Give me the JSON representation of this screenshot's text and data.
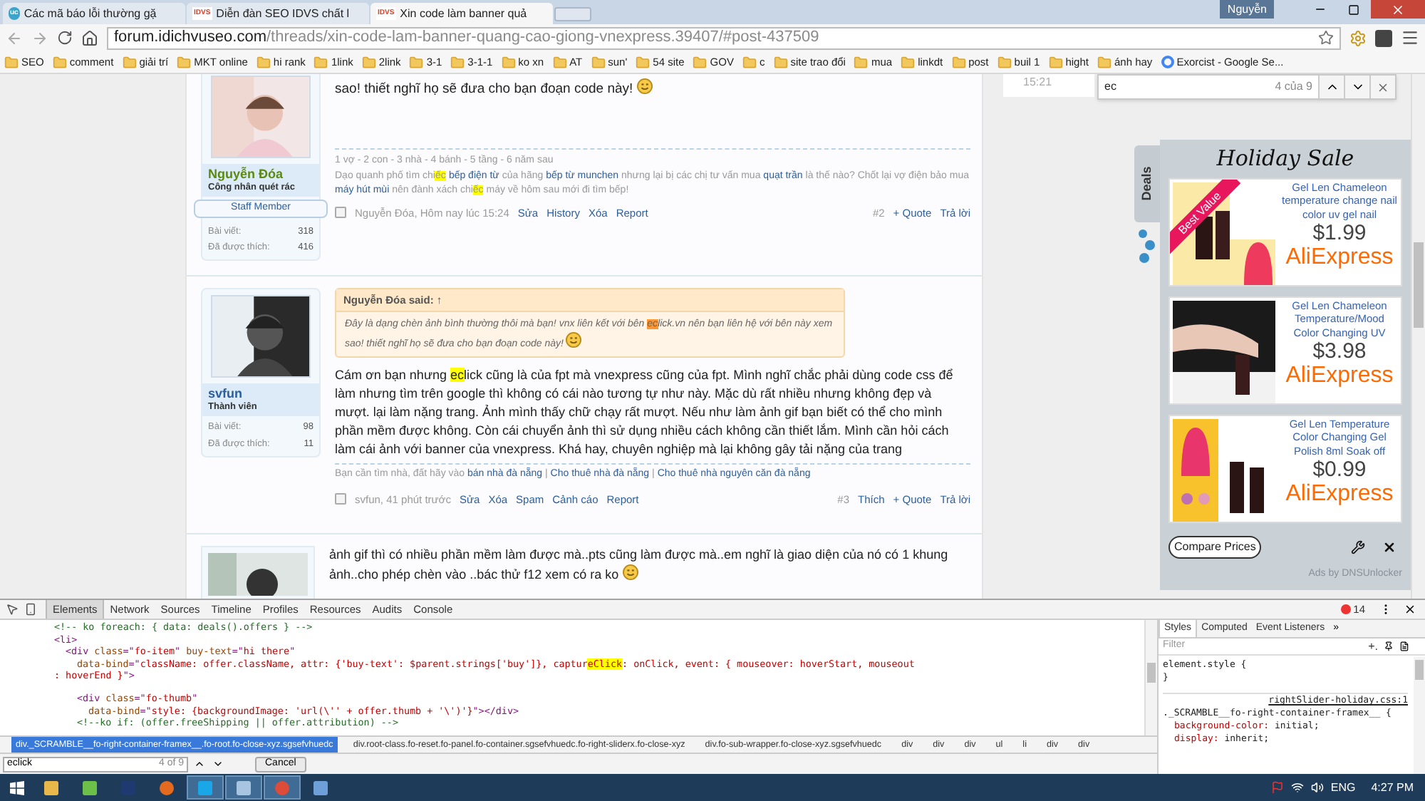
{
  "browser": {
    "tabs": [
      {
        "title": "Các mã báo lỗi thường gặ",
        "icon_text": "uc",
        "selected": false
      },
      {
        "title": "Diễn đàn SEO IDVS chất l",
        "icon_text": "IDVS",
        "selected": false
      },
      {
        "title": "Xin code làm banner quả",
        "icon_text": "IDVS",
        "selected": true
      }
    ],
    "profile": "Nguyễn",
    "address": {
      "host": "forum.idichvuseo.com",
      "path": "/threads/xin-code-lam-banner-quang-cao-giong-vnexpress.39407/#post-437509"
    },
    "bookmarks": [
      {
        "label": "SEO",
        "kind": "folder"
      },
      {
        "label": "comment",
        "kind": "folder"
      },
      {
        "label": "giải trí",
        "kind": "folder"
      },
      {
        "label": "MKT online",
        "kind": "folder"
      },
      {
        "label": "hi rank",
        "kind": "folder"
      },
      {
        "label": "1link",
        "kind": "folder"
      },
      {
        "label": "2link",
        "kind": "folder"
      },
      {
        "label": "3-1",
        "kind": "folder"
      },
      {
        "label": "3-1-1",
        "kind": "folder"
      },
      {
        "label": "ko xn",
        "kind": "folder"
      },
      {
        "label": "AT",
        "kind": "folder"
      },
      {
        "label": "sun'",
        "kind": "folder"
      },
      {
        "label": "54 site",
        "kind": "folder"
      },
      {
        "label": "GOV",
        "kind": "folder"
      },
      {
        "label": "c",
        "kind": "folder"
      },
      {
        "label": "site trao đổi",
        "kind": "folder"
      },
      {
        "label": "mua",
        "kind": "folder"
      },
      {
        "label": "linkdt",
        "kind": "folder"
      },
      {
        "label": "post",
        "kind": "folder"
      },
      {
        "label": "buil 1",
        "kind": "folder"
      },
      {
        "label": "hight",
        "kind": "folder"
      },
      {
        "label": "ánh hay",
        "kind": "folder"
      },
      {
        "label": "Exorcist - Google Se...",
        "kind": "page"
      }
    ]
  },
  "posts": [
    {
      "user": {
        "name": "Nguyễn Đóa",
        "title": "Công nhân quét rác",
        "badge": "Staff Member",
        "stats": [
          {
            "label": "Bài viết:",
            "value": "318"
          },
          {
            "label": "Đã được thích:",
            "value": "416"
          }
        ]
      },
      "body": [
        {
          "kind": "plain",
          "text": "sao! thiết nghĩ họ sẽ đưa cho bạn đoạn code này! "
        },
        {
          "kind": "emoji"
        }
      ],
      "signature": [
        [
          {
            "kind": "plain",
            "text": "1 vợ - 2 con - 3 nhà - 4 bánh - 5 tầng - 6 năm sau"
          }
        ],
        [
          {
            "kind": "plain",
            "text": "Dạo quanh phố tìm chi"
          },
          {
            "kind": "match",
            "text": "ếc"
          },
          {
            "kind": "link",
            "text": "bếp điện từ",
            "space_before": true
          },
          {
            "kind": "plain",
            "text": " của hãng "
          },
          {
            "kind": "link",
            "text": "bếp từ munchen"
          },
          {
            "kind": "plain",
            "text": " nhưng lại bị các chị tư vấn mua "
          },
          {
            "kind": "link",
            "text": "quạt trần"
          },
          {
            "kind": "plain",
            "text": " là thế nào? Chốt lại vợ điện bảo mua "
          },
          {
            "kind": "link",
            "text": "máy hút mùi"
          },
          {
            "kind": "plain",
            "text": " nên đành xách chi"
          },
          {
            "kind": "match",
            "text": "ếc"
          },
          {
            "kind": "plain",
            "text": " máy về hôm sau mới đi tìm bếp!"
          }
        ]
      ],
      "checked": false,
      "author_time": "Nguyễn Đóa, Hôm nay lúc 15:24",
      "actions": [
        "Sửa",
        "History",
        "Xóa",
        "Report"
      ],
      "number": "#2",
      "right_actions": [
        "+ Quote",
        "Trả lời"
      ]
    },
    {
      "user": {
        "name": "svfun",
        "title": "Thành viên",
        "stats": [
          {
            "label": "Bài viết:",
            "value": "98"
          },
          {
            "label": "Đã được thích:",
            "value": "11"
          }
        ]
      },
      "quote": {
        "author": "Nguyễn Đóa said: ↑",
        "text": [
          {
            "kind": "plain",
            "text": "Đây là dạng chèn ảnh bình thường thôi mà bạn! vnx liên kết với bên "
          },
          {
            "kind": "current",
            "text": "ec"
          },
          {
            "kind": "plain",
            "text": "lick.vn nên bạn liên hệ với bên này xem sao! thiết nghĩ họ sẽ đưa cho bạn đoạn code này! "
          },
          {
            "kind": "emoji"
          }
        ]
      },
      "body": [
        {
          "kind": "plain",
          "text": "Cám ơn bạn nhưng "
        },
        {
          "kind": "match",
          "text": "ec"
        },
        {
          "kind": "plain",
          "text": "lick cũng là của fpt mà vnexpress cũng của fpt. Mình nghĩ chắc phải dùng code css để làm nhưng tìm trên google thì không có cái nào tương tự như này. Mặc dù rất nhiều nhưng không đẹp và mượt. lại làm nặng trang. Ảnh mình thấy chữ chạy rất mượt. Nếu như làm ảnh gif bạn biết có thể cho mình phần mềm được không. Còn cái chuyển ảnh thì sử dụng nhiều cách không cần thiết lắm. Mình cần hỏi cách làm cái ảnh với banner của vnexpress. Khá hay, chuyên nghiệp mà lại không gây tải nặng của trang"
        }
      ],
      "signature": [
        [
          {
            "kind": "plain",
            "text": "Bạn cần tìm nhà, đất hãy vào "
          },
          {
            "kind": "link",
            "text": "bán nhà đà nẵng"
          },
          {
            "kind": "plain",
            "text": " | "
          },
          {
            "kind": "link",
            "text": "Cho thuê nhà đà nẵng"
          },
          {
            "kind": "plain",
            "text": " | "
          },
          {
            "kind": "link",
            "text": "Cho thuê nhà nguyên căn đà nẵng"
          }
        ]
      ],
      "checked": false,
      "author_time": "svfun, 41 phút trước",
      "actions": [
        "Sửa",
        "Xóa",
        "Spam",
        "Cảnh cáo",
        "Report"
      ],
      "number": "#3",
      "right_actions": [
        "Thích",
        "+ Quote",
        "Trả lời"
      ]
    },
    {
      "body": [
        {
          "kind": "plain",
          "text": "ảnh gif thì có nhiều phần mềm làm được mà..pts cũng làm được mà..em nghĩ là giao diện của nó có 1 khung ảnh..cho phép chèn vào ..bác thử f12 xem có ra ko "
        },
        {
          "kind": "emoji"
        }
      ]
    }
  ],
  "side_time": "15:21",
  "find_bar": {
    "value": "ec",
    "count": "4 của 9"
  },
  "deals": {
    "tab": "Deals",
    "title": "Holiday Sale",
    "items": [
      {
        "ribbon": "Best Value",
        "title": "Gel Len Chameleon temperature change nail color uv gel nail",
        "price": "$1.99",
        "store": "AliExpress"
      },
      {
        "title": "Gel Len Chameleon Temperature/Mood Color Changing UV",
        "price": "$3.98",
        "store": "AliExpress"
      },
      {
        "title": "Gel Len Temperature Color Changing Gel Polish 8ml Soak off",
        "price": "$0.99",
        "store": "AliExpress"
      }
    ],
    "compare_button": "Compare Prices",
    "footer": "Ads by DNSUnlocker"
  },
  "devtools": {
    "tabs": [
      {
        "label": "Elements",
        "selected": true
      },
      {
        "label": "Network",
        "selected": false
      },
      {
        "label": "Sources",
        "selected": false
      },
      {
        "label": "Timeline",
        "selected": false
      },
      {
        "label": "Profiles",
        "selected": false
      },
      {
        "label": "Resources",
        "selected": false
      },
      {
        "label": "Audits",
        "selected": false
      },
      {
        "label": "Console",
        "selected": false
      }
    ],
    "error_count": "14",
    "code_lines": [
      [
        {
          "kind": "comment",
          "text": "<!-- ko foreach: { data: deals().offers } -->"
        }
      ],
      [
        {
          "kind": "tag",
          "text": "<li>"
        }
      ],
      [
        {
          "kind": "tag",
          "text": "<div "
        },
        {
          "kind": "attr",
          "text": "class"
        },
        {
          "kind": "tag",
          "text": "=\""
        },
        {
          "kind": "value",
          "text": "fo-item"
        },
        {
          "kind": "tag",
          "text": "\" "
        },
        {
          "kind": "attr",
          "text": "buy-text"
        },
        {
          "kind": "tag",
          "text": "=\""
        },
        {
          "kind": "value",
          "text": "hi there"
        },
        {
          "kind": "tag",
          "text": "\""
        }
      ],
      [
        {
          "kind": "attr",
          "text": "data-bind"
        },
        {
          "kind": "tag",
          "text": "=\""
        },
        {
          "kind": "value",
          "text": "className: offer.className, attr: {'buy-text': $parent.strings['buy']}, captur"
        },
        {
          "kind": "match",
          "text": "eClick"
        },
        {
          "kind": "value",
          "text": ": onClick, event: { mouseover: hoverStart, mouseout"
        }
      ],
      [
        {
          "kind": "value",
          "text": ": hoverEnd }"
        },
        {
          "kind": "tag",
          "text": "\">"
        }
      ],
      [
        {
          "kind": "tag",
          "text": "<div "
        },
        {
          "kind": "attr",
          "text": "class"
        },
        {
          "kind": "tag",
          "text": "=\""
        },
        {
          "kind": "value",
          "text": "fo-thumb"
        },
        {
          "kind": "tag",
          "text": "\""
        }
      ],
      [
        {
          "kind": "attr",
          "text": "data-bind"
        },
        {
          "kind": "tag",
          "text": "=\""
        },
        {
          "kind": "value",
          "text": "style: {backgroundImage: 'url(\\'' + offer.thumb + '\\')'}"
        },
        {
          "kind": "tag",
          "text": "\"></div>"
        }
      ],
      [
        {
          "kind": "comment",
          "text": "<!--ko if: (offer.freeShipping || offer.attribution) -->"
        }
      ]
    ],
    "breadcrumbs": [
      {
        "label": "div._SCRAMBLE__fo-right-container-framex__.fo-root.fo-close-xyz.sgsefvhuedc",
        "selected": true
      },
      {
        "label": "div.root-class.fo-reset.fo-panel.fo-container.sgsefvhuedc.fo-right-sliderx.fo-close-xyz",
        "selected": false
      },
      {
        "label": "div.fo-sub-wrapper.fo-close-xyz.sgsefvhuedc",
        "selected": false
      },
      {
        "label": "div",
        "selected": false
      },
      {
        "label": "div",
        "selected": false
      },
      {
        "label": "div",
        "selected": false
      },
      {
        "label": "ul",
        "selected": false
      },
      {
        "label": "li",
        "selected": false
      },
      {
        "label": "div",
        "selected": false
      },
      {
        "label": "div",
        "selected": false
      }
    ],
    "find": {
      "value": "eclick",
      "count": "4 of 9",
      "cancel": "Cancel"
    },
    "styles_tabs": [
      {
        "label": "Styles",
        "selected": true
      },
      {
        "label": "Computed",
        "selected": false
      },
      {
        "label": "Event Listeners",
        "selected": false
      }
    ],
    "styles_more": "»",
    "filter_placeholder": "Filter",
    "new_rule": "+.",
    "style_lines": [
      {
        "kind": "rule",
        "text": "element.style {"
      },
      {
        "kind": "rule",
        "text": "}"
      },
      {
        "kind": "source",
        "text": "rightSlider-holiday.css:1"
      },
      {
        "kind": "rule",
        "text": "._SCRAMBLE__fo-right-container-framex__ {"
      },
      {
        "kind": "prop",
        "name": "background-color:",
        "value": "initial;"
      },
      {
        "kind": "prop",
        "name": "display:",
        "value": "inherit;"
      }
    ]
  },
  "taskbar": {
    "apps": [
      {
        "kind": "explorer",
        "running": false
      },
      {
        "kind": "maps",
        "running": false
      },
      {
        "kind": "photoshop",
        "running": false
      },
      {
        "kind": "firefox",
        "running": false
      },
      {
        "kind": "skype",
        "running": true
      },
      {
        "kind": "notepad",
        "running": true
      },
      {
        "kind": "chrome",
        "running": true
      },
      {
        "kind": "paint",
        "running": false
      }
    ],
    "language": "ENG",
    "time": "4:27 PM"
  }
}
